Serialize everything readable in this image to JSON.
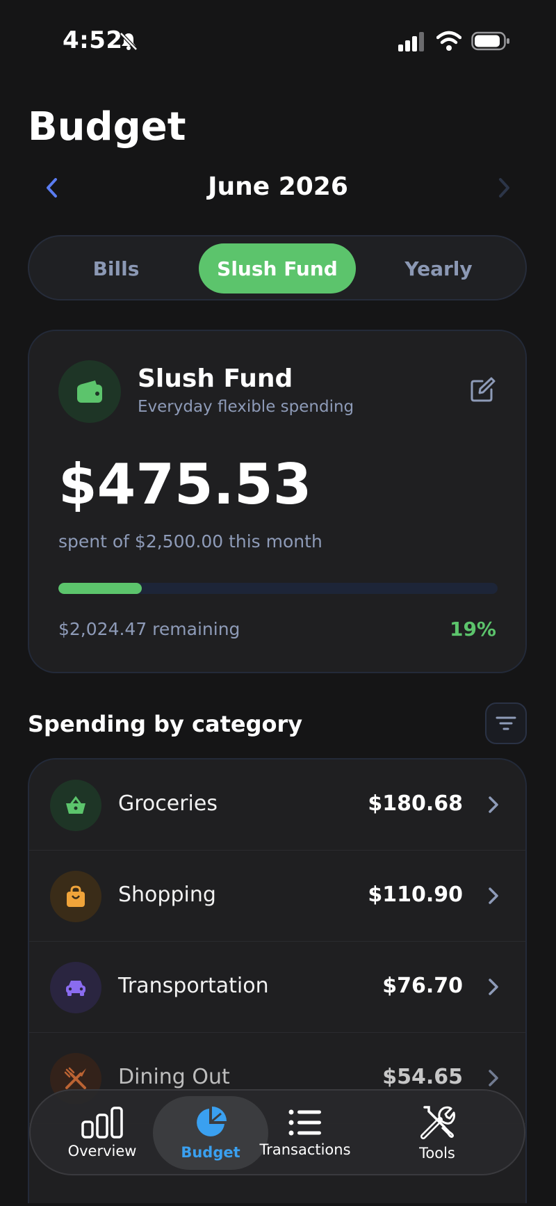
{
  "status_bar": {
    "time": "4:52"
  },
  "header": {
    "title": "Budget",
    "month": "June 2026"
  },
  "tabs": [
    {
      "label": "Bills",
      "active": false
    },
    {
      "label": "Slush Fund",
      "active": true
    },
    {
      "label": "Yearly",
      "active": false
    }
  ],
  "summary": {
    "title": "Slush Fund",
    "subtitle": "Everyday flexible spending",
    "amount": "$475.53",
    "spent_text": "spent of $2,500.00 this month",
    "progress": 0.19,
    "remaining": "$2,024.47 remaining",
    "percent": "19%"
  },
  "section": {
    "title": "Spending by category"
  },
  "categories": [
    {
      "name": "Groceries",
      "amount": "$180.68",
      "icon": "basket-icon",
      "color": "#5cc46c",
      "bg": "#1e3526"
    },
    {
      "name": "Shopping",
      "amount": "$110.90",
      "icon": "shopping-bag-icon",
      "color": "#f0a43a",
      "bg": "#3a2c18"
    },
    {
      "name": "Transportation",
      "amount": "$76.70",
      "icon": "car-icon",
      "color": "#8a6cf0",
      "bg": "#2a2540"
    },
    {
      "name": "Dining Out",
      "amount": "$54.65",
      "icon": "utensils-icon",
      "color": "#f07a3a",
      "bg": "#3a2418"
    }
  ],
  "nav": [
    {
      "label": "Overview",
      "icon": "bar-chart-icon",
      "active": false
    },
    {
      "label": "Budget",
      "icon": "pie-chart-icon",
      "active": true
    },
    {
      "label": "Transactions",
      "icon": "list-icon",
      "active": false
    },
    {
      "label": "Tools",
      "icon": "tools-icon",
      "active": false
    }
  ],
  "colors": {
    "accent": "#5cc46c",
    "nav_active": "#3aa0f0",
    "background": "#151516"
  }
}
